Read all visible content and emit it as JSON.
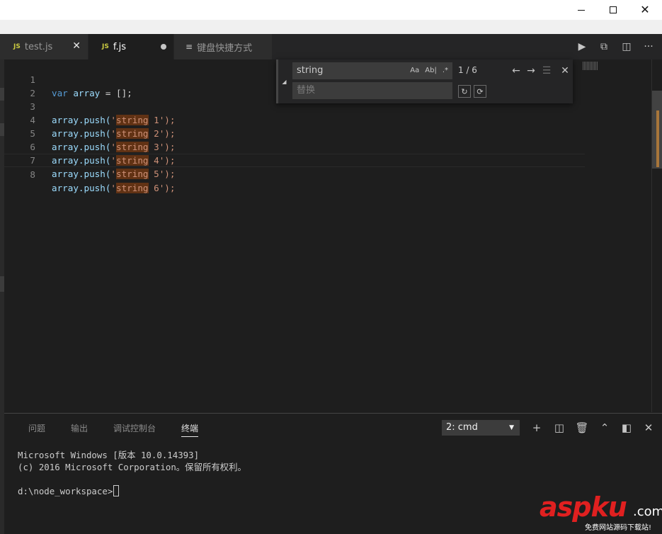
{
  "window": {
    "controls": [
      "minimize",
      "maximize",
      "close"
    ]
  },
  "tabs": [
    {
      "icon": "JS",
      "label": "test.js",
      "state": "close"
    },
    {
      "icon": "JS",
      "label": "f.js",
      "state": "dirty",
      "active": true
    },
    {
      "icon": "keyboard-icon",
      "label": "键盘快捷方式",
      "state": "none"
    }
  ],
  "editor": {
    "lines": [
      {
        "n": "1"
      },
      {
        "n": "2"
      },
      {
        "n": "3"
      },
      {
        "n": "4"
      },
      {
        "n": "5"
      },
      {
        "n": "6"
      },
      {
        "n": "7"
      },
      {
        "n": "8"
      }
    ],
    "code": {
      "l1": {
        "kw": "var",
        "name": "array",
        "rest": " = [];"
      },
      "call": "array.push(",
      "quote": "'",
      "match": "string",
      "tail": "');",
      "nums": [
        "1",
        "2",
        "3",
        "4",
        "5",
        "6"
      ]
    }
  },
  "find": {
    "query": "string",
    "replace_placeholder": "替换",
    "options": [
      "Aa",
      "Ab|",
      ".*"
    ],
    "count": "1 / 6"
  },
  "panel": {
    "tabs": [
      "问题",
      "输出",
      "调试控制台",
      "终端"
    ],
    "active_tab": "终端",
    "terminal_select": "2: cmd",
    "terminal_lines": [
      "Microsoft Windows [版本 10.0.14393]",
      "(c) 2016 Microsoft Corporation。保留所有权利。",
      "",
      "d:\\node_workspace>"
    ]
  },
  "watermark": {
    "logo_a": "asp",
    "logo_b": "ku",
    "suffix": ".com",
    "tagline": "免费网站源码下载站!"
  },
  "colors": {
    "accent_highlight": "#613214",
    "keyword": "#569cd6",
    "string": "#ce9178",
    "watermark": "#e02020"
  }
}
